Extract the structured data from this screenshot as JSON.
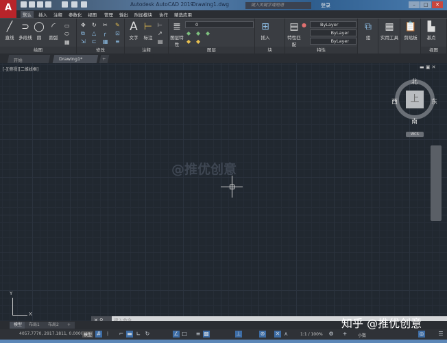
{
  "title": {
    "app": "Autodesk AutoCAD 2019",
    "document": "Drawing1.dwg",
    "search_placeholder": "键入关键字或短语",
    "login": "登录",
    "logo": "A"
  },
  "ribbon_tabs": [
    "默认",
    "插入",
    "注释",
    "参数化",
    "视图",
    "管理",
    "输出",
    "附加模块",
    "协作",
    "精选应用"
  ],
  "panels": {
    "draw": {
      "label": "绘图",
      "tools": [
        "直线",
        "多段线",
        "圆",
        "圆弧"
      ]
    },
    "modify": {
      "label": "修改"
    },
    "annotation": {
      "label": "注释",
      "tools": [
        "文字",
        "标注"
      ]
    },
    "layers": {
      "label": "图层",
      "tools": [
        "图层特性"
      ],
      "current_layer": "0"
    },
    "block": {
      "label": "块",
      "tools": [
        "插入"
      ]
    },
    "properties": {
      "label": "特性",
      "tools": [
        "特性匹配"
      ],
      "color": "ByLayer",
      "linetype": "ByLayer",
      "lineweight": "ByLayer"
    },
    "groups": {
      "label": "组"
    },
    "utilities": {
      "label": "实用工具"
    },
    "clipboard": {
      "label": "剪贴板"
    },
    "view": {
      "label": "视图",
      "tools": [
        "基点"
      ]
    }
  },
  "doc_tabs": [
    "开始",
    "Drawing1*"
  ],
  "viewport": {
    "label": "[-][俯视][二维线框]",
    "watermark": "@推优创意"
  },
  "viewcube": {
    "north": "北",
    "south": "南",
    "east": "东",
    "west": "西",
    "face": "上",
    "wcs": "WCS"
  },
  "ucs": {
    "x": "X",
    "y": "Y"
  },
  "command": {
    "placeholder": "键入命令"
  },
  "layout_tabs": [
    "模型",
    "布局1",
    "布局2"
  ],
  "status": {
    "coords": "4057.7770, 2917.1811, 0.0000",
    "model": "模型",
    "scale": "1:1 / 100%",
    "units": "小数"
  },
  "overlay": {
    "zhihu": "知乎 @推优创意"
  }
}
